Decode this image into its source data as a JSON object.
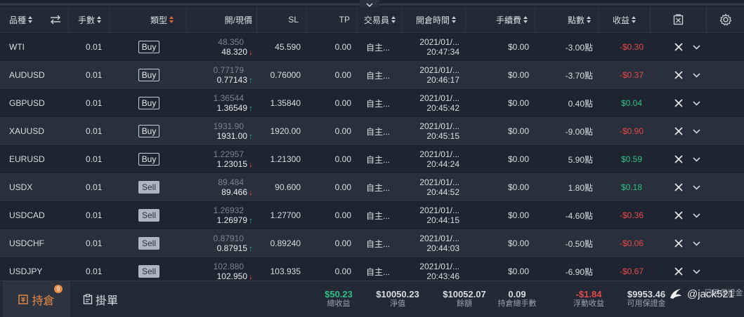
{
  "header": {
    "symbol": "品種",
    "lots": "手數",
    "type": "類型",
    "price": "開/現價",
    "sl": "SL",
    "tp": "TP",
    "trader": "交易員",
    "open_time": "開倉時間",
    "fee": "手續費",
    "points": "點數",
    "profit": "收益"
  },
  "rows": [
    {
      "symbol": "WTI",
      "lots": "0.01",
      "type": "Buy",
      "open": "48.350",
      "current": "48.320",
      "dir": "down",
      "sl": "45.590",
      "tp": "0.00",
      "trader": "自主...",
      "date": "2021/01/...",
      "time": "20:47:34",
      "fee": "$0.00",
      "points": "-3.00點",
      "profit": "-$0.30",
      "sign": "neg"
    },
    {
      "symbol": "AUDUSD",
      "lots": "0.01",
      "type": "Buy",
      "open": "0.77179",
      "current": "0.77143",
      "dir": "up",
      "sl": "0.76000",
      "tp": "0.00",
      "trader": "自主...",
      "date": "2021/01/...",
      "time": "20:46:17",
      "fee": "$0.00",
      "points": "-3.70點",
      "profit": "-$0.37",
      "sign": "neg"
    },
    {
      "symbol": "GBPUSD",
      "lots": "0.01",
      "type": "Buy",
      "open": "1.36544",
      "current": "1.36549",
      "dir": "up",
      "sl": "1.35840",
      "tp": "0.00",
      "trader": "自主...",
      "date": "2021/01/...",
      "time": "20:45:42",
      "fee": "$0.00",
      "points": "0.40點",
      "profit": "$0.04",
      "sign": "pos"
    },
    {
      "symbol": "XAUUSD",
      "lots": "0.01",
      "type": "Buy",
      "open": "1931.90",
      "current": "1931.00",
      "dir": "up",
      "sl": "1920.00",
      "tp": "0.00",
      "trader": "自主...",
      "date": "2021/01/...",
      "time": "20:45:15",
      "fee": "$0.00",
      "points": "-9.00點",
      "profit": "-$0.90",
      "sign": "neg"
    },
    {
      "symbol": "EURUSD",
      "lots": "0.01",
      "type": "Buy",
      "open": "1.22957",
      "current": "1.23015",
      "dir": "down",
      "sl": "1.21300",
      "tp": "0.00",
      "trader": "自主...",
      "date": "2021/01/...",
      "time": "20:44:24",
      "fee": "$0.00",
      "points": "5.90點",
      "profit": "$0.59",
      "sign": "pos"
    },
    {
      "symbol": "USDX",
      "lots": "0.01",
      "type": "Sell",
      "open": "89.484",
      "current": "89.466",
      "dir": "down",
      "sl": "90.600",
      "tp": "0.00",
      "trader": "自主...",
      "date": "2021/01/...",
      "time": "20:44:52",
      "fee": "$0.00",
      "points": "1.80點",
      "profit": "$0.18",
      "sign": "pos"
    },
    {
      "symbol": "USDCAD",
      "lots": "0.01",
      "type": "Sell",
      "open": "1.26932",
      "current": "1.26979",
      "dir": "up",
      "sl": "1.27700",
      "tp": "0.00",
      "trader": "自主...",
      "date": "2021/01/...",
      "time": "20:44:15",
      "fee": "$0.00",
      "points": "-4.60點",
      "profit": "-$0.36",
      "sign": "neg"
    },
    {
      "symbol": "USDCHF",
      "lots": "0.01",
      "type": "Sell",
      "open": "0.87910",
      "current": "0.87915",
      "dir": "up",
      "sl": "0.89240",
      "tp": "0.00",
      "trader": "自主...",
      "date": "2021/01/...",
      "time": "20:44:03",
      "fee": "$0.00",
      "points": "-0.50點",
      "profit": "-$0.06",
      "sign": "neg"
    },
    {
      "symbol": "USDJPY",
      "lots": "0.01",
      "type": "Sell",
      "open": "102.880",
      "current": "102.950",
      "dir": "down",
      "sl": "103.935",
      "tp": "0.00",
      "trader": "自主...",
      "date": "2021/01/...",
      "time": "20:43:46",
      "fee": "$0.00",
      "points": "-6.90點",
      "profit": "-$0.67",
      "sign": "neg"
    }
  ],
  "footer": {
    "positions_tab": "持倉",
    "positions_count": "9",
    "orders_tab": "掛單",
    "summaries": [
      {
        "value": "$50.23",
        "label": "總收益",
        "color": "#2fbf86"
      },
      {
        "value": "$10050.23",
        "label": "淨值",
        "color": "#d9dde3"
      },
      {
        "value": "$10052.07",
        "label": "餘額",
        "color": "#d9dde3"
      },
      {
        "value": "0.09",
        "label": "持倉總手數",
        "color": "#d9dde3"
      },
      {
        "value": "-$1.84",
        "label": "浮動收益",
        "color": "#e2494d"
      },
      {
        "value": "$9953.46",
        "label": "可用保證金",
        "color": "#d9dde3"
      },
      {
        "value": "",
        "label": "已用保證金",
        "color": "#d9dde3"
      }
    ],
    "watermark": "@jack521"
  },
  "colors": {
    "positive": "#2fbf86",
    "negative": "#e2494d",
    "accent": "#e78b46"
  },
  "icons": {
    "swap": "swap-icon",
    "export": "export-icon",
    "settings": "gear-icon",
    "close": "close-icon",
    "expand": "chevron-down-icon"
  }
}
